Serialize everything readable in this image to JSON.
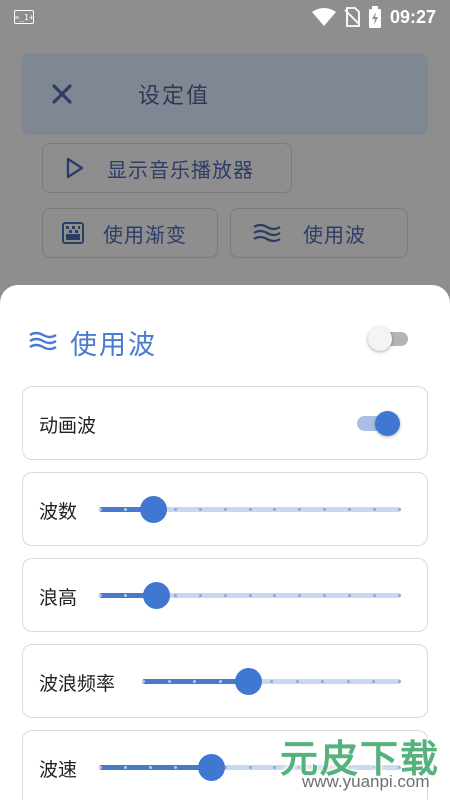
{
  "status_bar": {
    "terminal_icon_text": ">_1+",
    "time": "09:27",
    "icons": [
      "terminal-icon",
      "wifi-icon",
      "no-sim-icon",
      "battery-charging-icon"
    ]
  },
  "background": {
    "header": {
      "close_icon": "close-icon",
      "title": "设定值"
    },
    "buttons": [
      {
        "icon": "play-icon",
        "label": "显示音乐播放器"
      },
      {
        "icon": "gradient-icon",
        "label": "使用渐变"
      },
      {
        "icon": "wave-icon",
        "label": "使用波"
      }
    ]
  },
  "sheet": {
    "icon": "wave-icon",
    "title": "使用波",
    "enabled": false,
    "animated_wave": {
      "label": "动画波",
      "enabled": true
    },
    "sliders": [
      {
        "label": "波数",
        "value": 0.18,
        "ticks": 12
      },
      {
        "label": "浪高",
        "value": 0.19,
        "ticks": 12
      },
      {
        "label": "波浪频率",
        "value": 0.41,
        "ticks": 10
      },
      {
        "label": "波速",
        "value": 0.37,
        "ticks": 12
      }
    ]
  },
  "watermark": {
    "main": "元皮下载",
    "url": "www.yuanpi.com"
  },
  "colors": {
    "accent": "#3f77d1",
    "title": "#4a7bd0",
    "rail": "#c9d8f0",
    "scrim": "#8e8e8e"
  }
}
